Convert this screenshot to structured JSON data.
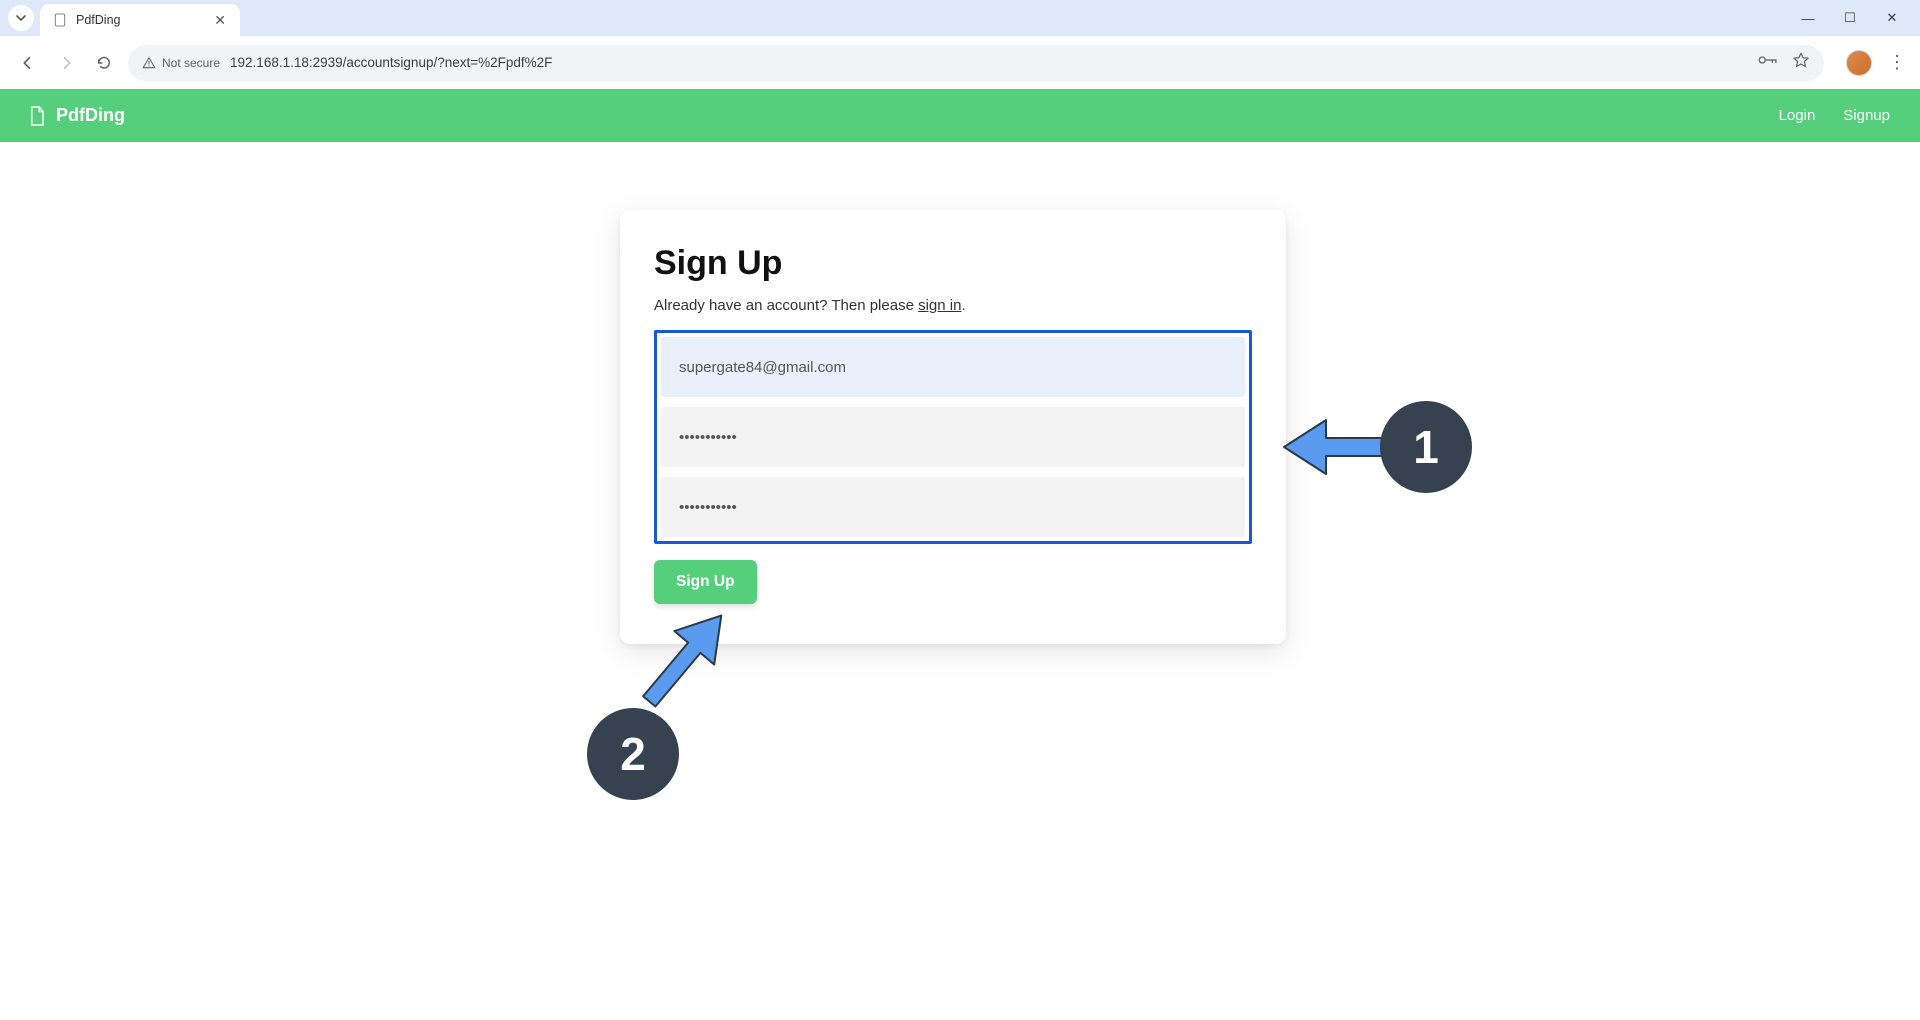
{
  "browser": {
    "tab_title": "PdfDing",
    "url": "192.168.1.18:2939/accountsignup/?next=%2Fpdf%2F",
    "not_secure_label": "Not secure"
  },
  "header": {
    "brand": "PdfDing",
    "login_label": "Login",
    "signup_label": "Signup"
  },
  "card": {
    "title": "Sign Up",
    "subtext_prefix": "Already have an account? Then please ",
    "subtext_link": "sign in",
    "subtext_suffix": ".",
    "email_value": "supergate84@gmail.com",
    "password1_value": "•••••••••••",
    "password2_value": "•••••••••••",
    "submit_label": "Sign Up"
  },
  "annotations": {
    "badge1": "1",
    "badge2": "2"
  },
  "colors": {
    "accent_green": "#55cf7b",
    "annotation_blue": "#5a9bef",
    "annotation_dark": "#36424f",
    "highlight_border": "#1659d6"
  }
}
